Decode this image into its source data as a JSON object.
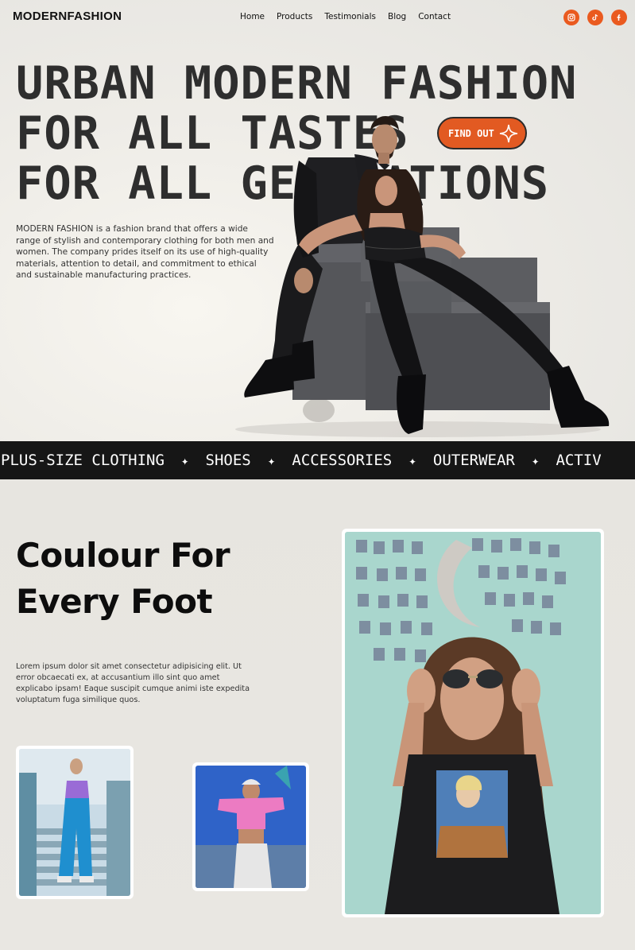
{
  "brand": {
    "logo": "MODERNFASHION"
  },
  "nav": {
    "items": [
      "Home",
      "Products",
      "Testimonials",
      "Blog",
      "Contact"
    ]
  },
  "socials": [
    "instagram-icon",
    "tiktok-icon",
    "facebook-icon"
  ],
  "colors": {
    "accent": "#e25a22",
    "dark": "#161616",
    "heading": "#2e2e2e"
  },
  "hero": {
    "headline_lines": [
      "URBAN MODERN FASHION",
      "FOR ALL TASTES",
      "FOR ALL GENERATIONS"
    ],
    "cta_label": "FIND OUT",
    "description": "MODERN FASHION is a fashion brand that offers a wide range of stylish and contemporary clothing for both men and women. The company prides itself on its use of high-quality materials, attention to detail, and commitment to ethical and sustainable manufacturing practices."
  },
  "ticker": {
    "items": [
      "PLUS-SIZE CLOTHING",
      "SHOES",
      "ACCESSORIES",
      "OUTERWEAR",
      "ACTIV"
    ]
  },
  "section2": {
    "title_line1": "Coulour For",
    "title_line2": "Every Foot",
    "description": "Lorem ipsum dolor sit amet consectetur adipisicing elit. Ut error obcaecati ex, at accusantium illo sint quo amet explicabo ipsam! Eaque suscipit cumque animi iste expedita voluptatum fuga similique quos."
  }
}
